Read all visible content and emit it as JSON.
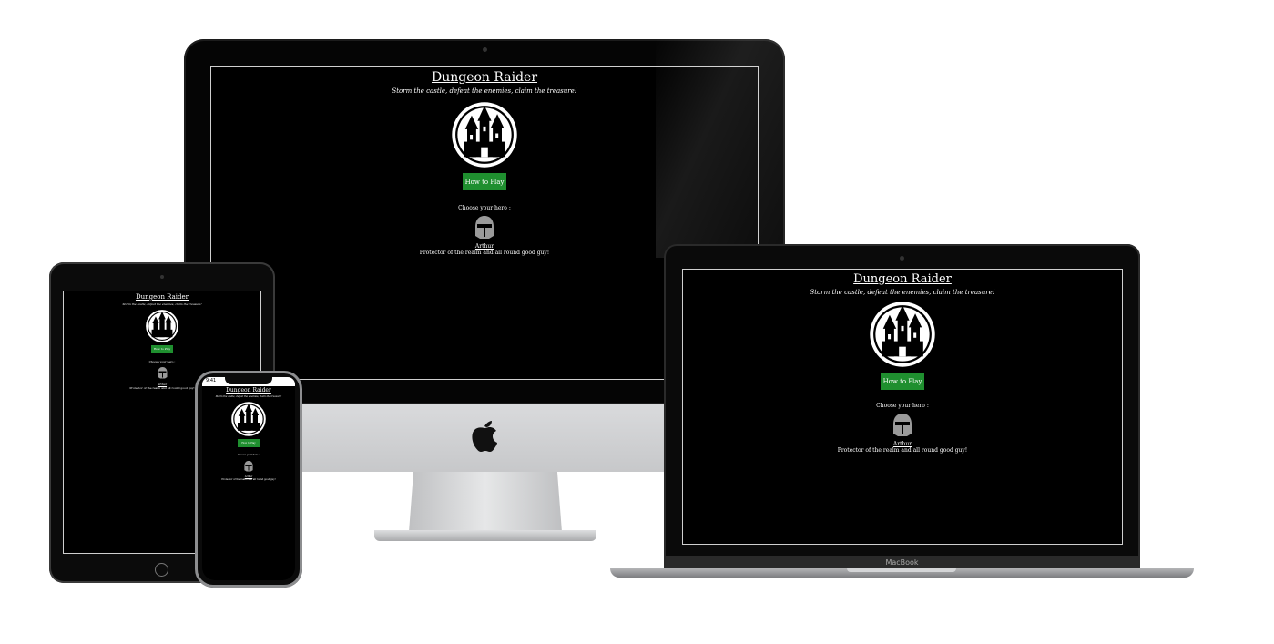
{
  "app": {
    "title": "Dungeon Raider",
    "tagline": "Storm the castle, defeat the enemies, claim the treasure!",
    "how_to_play_label": "How to Play",
    "choose_hero_label": "Choose your hero :",
    "hero": {
      "name": "Arthur",
      "description": "Protector of the realm and all  round good guy!"
    },
    "button_color": "#1f8f2f",
    "background_color": "#000000"
  },
  "devices": {
    "laptop_brand": "MacBook",
    "phone_time": "9:41"
  },
  "icons": {
    "logo": "castle-icon",
    "hero_avatar": "knight-helmet-icon",
    "brand": "apple-logo-icon"
  }
}
